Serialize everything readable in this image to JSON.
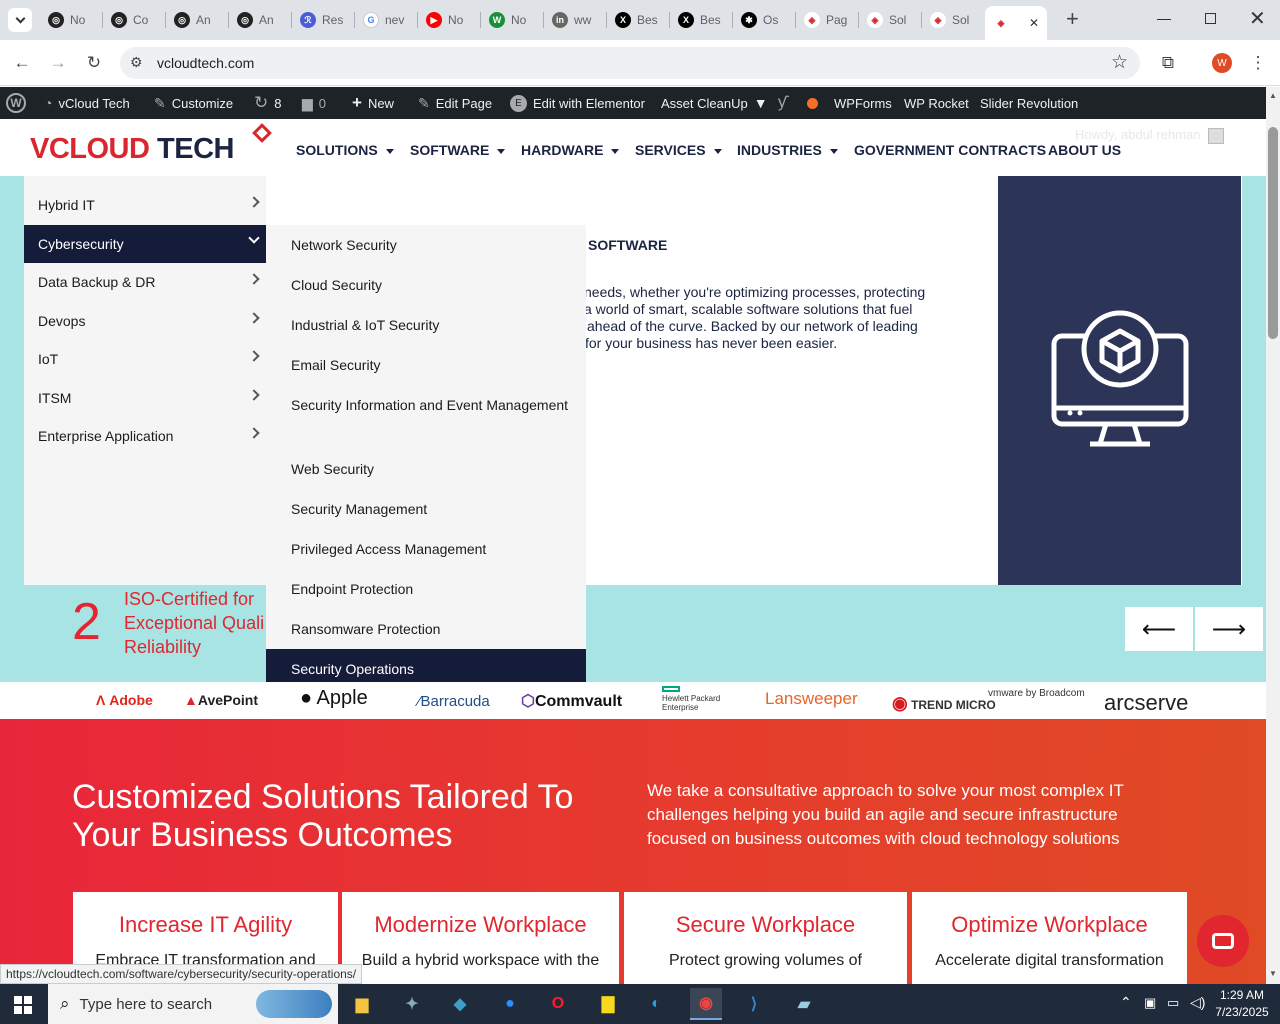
{
  "browser": {
    "tabs": [
      {
        "label": "No",
        "icon": "openai-icon"
      },
      {
        "label": "Co",
        "icon": "openai-icon"
      },
      {
        "label": "An",
        "icon": "openai-icon"
      },
      {
        "label": "An",
        "icon": "openai-icon"
      },
      {
        "label": "Res",
        "icon": "app-icon"
      },
      {
        "label": "nev",
        "icon": "google-icon"
      },
      {
        "label": "No",
        "icon": "youtube-icon"
      },
      {
        "label": "No",
        "icon": "w-icon"
      },
      {
        "label": "ww",
        "icon": "linkedin-icon"
      },
      {
        "label": "Bes",
        "icon": "x-icon"
      },
      {
        "label": "Bes",
        "icon": "x-icon"
      },
      {
        "label": "Os",
        "icon": "x-dark-icon"
      },
      {
        "label": "Pag",
        "icon": "vcloud-icon"
      },
      {
        "label": "Sol",
        "icon": "vcloud-icon"
      },
      {
        "label": "Sol",
        "icon": "vcloud-icon"
      },
      {
        "label": "",
        "icon": "vcloud-icon"
      }
    ],
    "url": "vcloudtech.com",
    "profile_initial": "W",
    "status_url": "https://vcloudtech.com/software/cybersecurity/security-operations/"
  },
  "wpbar": {
    "site": "vCloud Tech",
    "customize": "Customize",
    "updates": "8",
    "comments": "0",
    "new": "New",
    "edit_page": "Edit Page",
    "elementor": "Edit with Elementor",
    "asset_cleanup": "Asset CleanUp",
    "wpforms": "WPForms",
    "wprocket": "WP Rocket",
    "slider": "Slider Revolution",
    "howdy": "Howdy, abdul rehman"
  },
  "header": {
    "logo_part1": "VCLOUD",
    "logo_part2": "TECH",
    "nav": [
      "SOLUTIONS",
      "SOFTWARE",
      "HARDWARE",
      "SERVICES",
      "INDUSTRIES",
      "GOVERNMENT CONTRACTS",
      "ABOUT US"
    ]
  },
  "megamenu": {
    "left_items": [
      "Hybrid IT",
      "Cybersecurity",
      "Data Backup & DR",
      "Devops",
      "IoT",
      "ITSM",
      "Enterprise Application"
    ],
    "selected": "Cybersecurity",
    "sub_items": [
      "Network Security",
      "Cloud Security",
      "Industrial & IoT Security",
      "Email Security",
      "Security Information and Event Management",
      "Web Security",
      "Security Management",
      "Privileged Access Management",
      "Endpoint Protection",
      "Ransomware Protection",
      "Security Operations"
    ],
    "highlighted": "Security Operations"
  },
  "hero": {
    "heading_fragment": "SOFTWARE",
    "text_lines": [
      "needs, whether you're optimizing processes, protecting",
      "a world of smart, scalable software solutions that fuel",
      "ahead of the curve. Backed by our network of leading",
      "for your business has never been easier."
    ],
    "stat_number": "2",
    "stat_lines": [
      "ISO-Certified for",
      "Exceptional Quali",
      "Reliability"
    ]
  },
  "brands": [
    "Adobe",
    "AvePoint",
    "Apple",
    "Barracuda",
    "Commvault",
    "Hewlett Packard Enterprise",
    "Lansweeper",
    "TREND MICRO",
    "vmware by Broadcom",
    "arcserve"
  ],
  "section": {
    "title_line1": "Customized Solutions Tailored To",
    "title_line2": "Your Business Outcomes",
    "desc_lines": [
      "We take a consultative approach to solve your most complex IT",
      "challenges helping you build an agile and secure infrastructure",
      "focused on business outcomes with cloud technology solutions"
    ],
    "cards": [
      {
        "title": "Increase IT Agility",
        "text": "Embrace IT transformation and"
      },
      {
        "title": "Modernize Workplace",
        "text": "Build a hybrid workspace with the"
      },
      {
        "title": "Secure Workplace",
        "text": "Protect growing volumes of"
      },
      {
        "title": "Optimize Workplace",
        "text": "Accelerate digital transformation"
      }
    ]
  },
  "taskbar": {
    "search_placeholder": "Type here to search",
    "time": "1:29 AM",
    "date": "7/23/2025"
  },
  "colors": {
    "navy": "#151c3a",
    "hero_bg": "#a8e4e4",
    "red": "#e8263a",
    "accent_red": "#e1262f"
  }
}
